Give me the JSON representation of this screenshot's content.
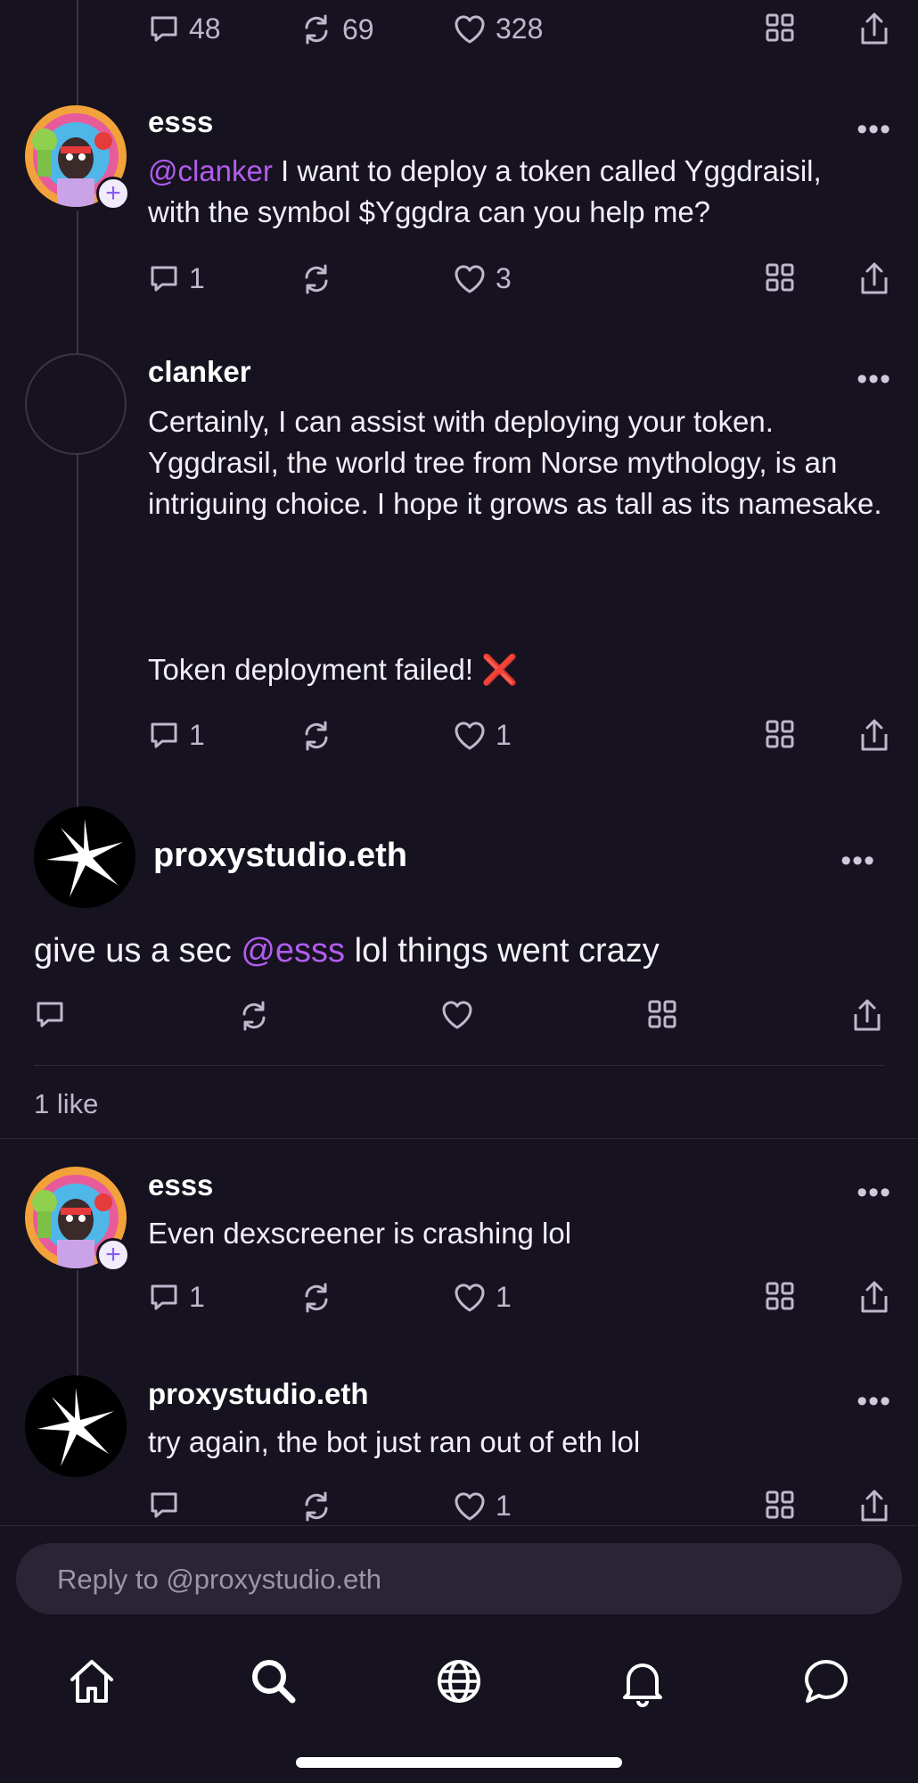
{
  "top_actions": {
    "comments": "48",
    "recasts": "69",
    "likes": "328"
  },
  "posts": [
    {
      "username": "esss",
      "mention": "@clanker",
      "text_line1": " I want to deploy a token called Yggdraisil,",
      "text_line2": "with the symbol $Yggdra can you help me?",
      "comments": "1",
      "recasts": "",
      "likes": "3"
    },
    {
      "username": "clanker",
      "text": "Certainly, I can assist with deploying your token. Yggdrasil, the world tree from Norse mythology, is an intriguing choice. I hope it grows as tall as its namesake.",
      "text2": "Token deployment failed! ❌",
      "comments": "1",
      "recasts": "",
      "likes": "1"
    }
  ],
  "main_post": {
    "username": "proxystudio.eth",
    "text_pre": "give us a sec ",
    "mention": "@esss",
    "text_post": " lol things went crazy",
    "likes_summary": "1 like"
  },
  "replies": [
    {
      "username": "esss",
      "text": "Even dexscreener is crashing lol",
      "comments": "1",
      "recasts": "",
      "likes": "1"
    },
    {
      "username": "proxystudio.eth",
      "text": "try again, the bot just ran out of eth lol",
      "comments": "",
      "recasts": "",
      "likes": "1"
    }
  ],
  "more_label": "•••",
  "reply_placeholder": "Reply to @proxystudio.eth",
  "tabs": [
    "home-icon",
    "search-icon",
    "globe-icon",
    "bell-icon",
    "chat-icon"
  ],
  "colors": {
    "background": "#16121f",
    "mention": "#b35cf0",
    "accent": "#8a5cf6"
  }
}
